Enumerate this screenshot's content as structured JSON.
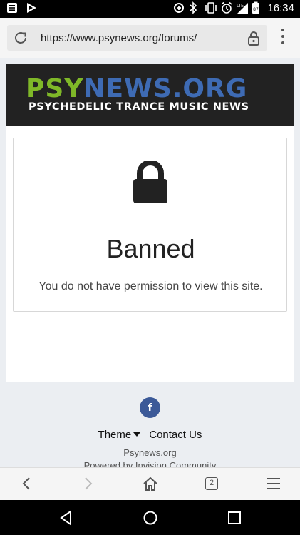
{
  "status_bar": {
    "time": "16:34",
    "left_icons": [
      "notification-doc-icon",
      "play-store-icon"
    ],
    "right_icons": [
      "data-saver-icon",
      "bluetooth-icon",
      "vibrate-icon",
      "alarm-icon",
      "lte-signal-icon",
      "battery-icon"
    ],
    "battery_level": "87"
  },
  "browser": {
    "url": "https://www.psynews.org/forums/",
    "tab_count": "2"
  },
  "site": {
    "logo_psy": "PSY",
    "logo_news": "NEWS.ORG",
    "logo_tagline": "PSYCHEDELIC TRANCE MUSIC NEWS",
    "logo_psy_color": "#7fb828",
    "logo_news_color": "#3e6bb4"
  },
  "error": {
    "title": "Banned",
    "message": "You do not have permission to view this site."
  },
  "footer": {
    "social": "f",
    "theme_label": "Theme",
    "contact_label": "Contact Us",
    "site_name": "Psynews.org",
    "powered_by": "Powered by Invision Community"
  }
}
